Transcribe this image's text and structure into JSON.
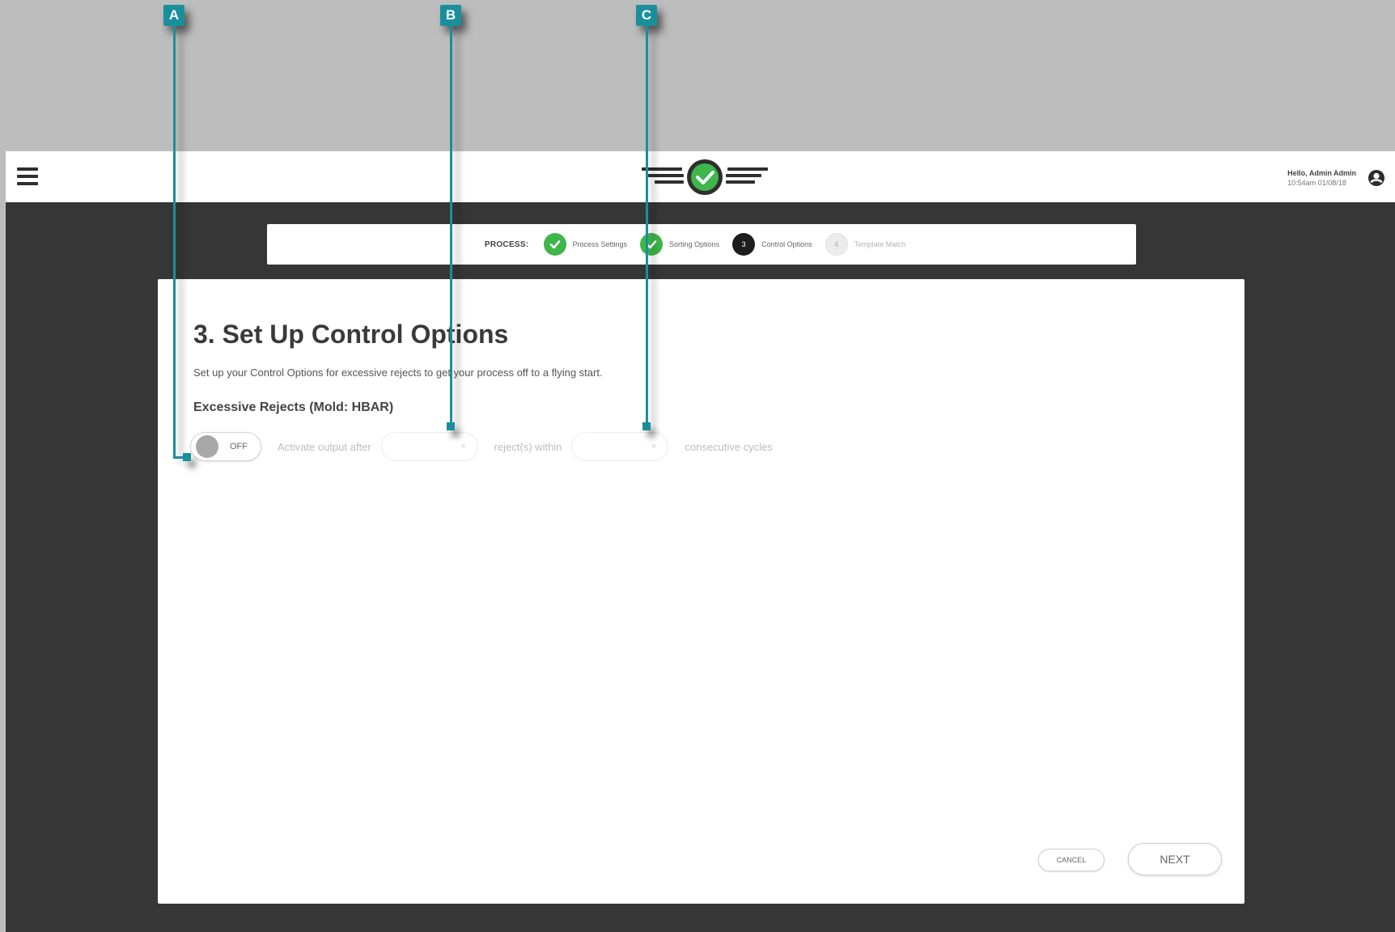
{
  "header": {
    "user_greeting": "Hello, Admin Admin",
    "user_datetime": "10:54am 01/08/18"
  },
  "stepper": {
    "label": "PROCESS:",
    "steps": [
      {
        "label": "Process Settings",
        "state": "done",
        "marker": ""
      },
      {
        "label": "Sorting Options",
        "state": "done",
        "marker": ""
      },
      {
        "label": "Control Options",
        "state": "current",
        "marker": "3"
      },
      {
        "label": "Template Match",
        "state": "pending",
        "marker": "4"
      }
    ]
  },
  "card": {
    "title": "3. Set Up Control Options",
    "subtitle": "Set up your Control Options for excessive rejects to get your process off to a flying start.",
    "section_title": "Excessive Rejects (Mold: HBAR)",
    "rule": {
      "toggle_label": "OFF",
      "text_activate": "Activate output after",
      "rejects_value": "",
      "rejects_clear": "×",
      "text_within": "reject(s) within",
      "cycles_value": "",
      "cycles_clear": "×",
      "text_cycles": "consecutive cycles"
    },
    "cancel_label": "CANCEL",
    "next_label": "NEXT"
  },
  "callouts": {
    "a": "A",
    "b": "B",
    "c": "C"
  },
  "colors": {
    "accent_teal": "#1a8f9c",
    "success_green": "#3fb54a",
    "background_dark": "#363636",
    "background_outer": "#bdbdbd"
  }
}
